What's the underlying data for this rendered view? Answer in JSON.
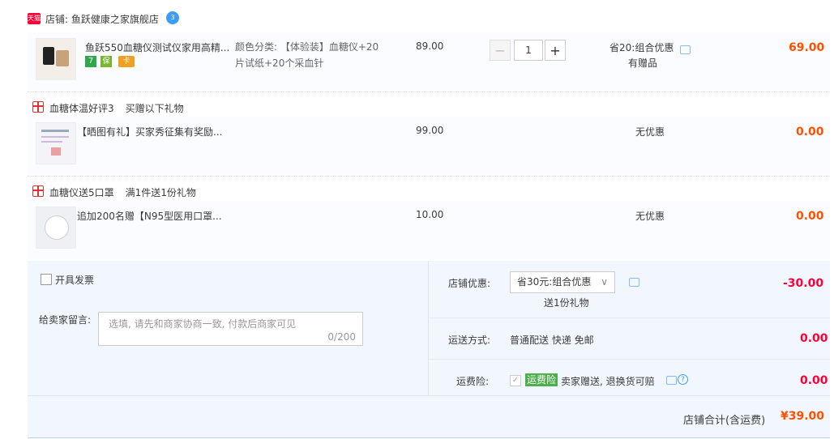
{
  "shop": {
    "badge": "天猫",
    "name": "店铺: 鱼跃健康之家旗舰店",
    "ww_badge": "3"
  },
  "items": [
    {
      "title": "鱼跃550血糖仪测试仪家用高精...",
      "sku": "颜色分类: 【体验装】血糖仪+20片试纸+20个采血针",
      "price": "89.00",
      "qty": "1",
      "promo": "省20:组合优惠",
      "promo_sub": "有赠品",
      "total": "69.00",
      "badges": [
        "7",
        "保",
        "卡"
      ]
    }
  ],
  "gifts": [
    {
      "header": "血糖体温好评3",
      "header_note": "买赠以下礼物",
      "title": "【晒图有礼】买家秀征集有奖励...",
      "price": "99.00",
      "promo": "无优惠",
      "total": "0.00"
    },
    {
      "header": "血糖仪送5口罩",
      "header_note": "满1件送1份礼物",
      "title": "追加200名赠【N95型医用口罩...",
      "price": "10.00",
      "promo": "无优惠",
      "total": "0.00"
    }
  ],
  "invoice": {
    "label": "开具发票"
  },
  "message": {
    "label": "给卖家留言:",
    "placeholder": "选填, 请先和商家协商一致, 付款后商家可见",
    "counter": "0/200"
  },
  "shop_discount": {
    "label": "店铺优惠:",
    "selected": "省30元:组合优惠",
    "sub": "送1份礼物",
    "amount": "-30.00"
  },
  "shipping": {
    "label": "运送方式:",
    "value": "普通配送 快递 免邮",
    "amount": "0.00"
  },
  "insurance": {
    "label": "运费险:",
    "tag": "运费险",
    "value": "卖家赠送, 退换货可赔",
    "amount": "0.00"
  },
  "summary": {
    "label": "店铺合计(含运费)",
    "amount": "¥39.00"
  },
  "colors": {
    "accent": "#ff5000",
    "red": "#ff0036",
    "panel": "#f2f7ff"
  }
}
